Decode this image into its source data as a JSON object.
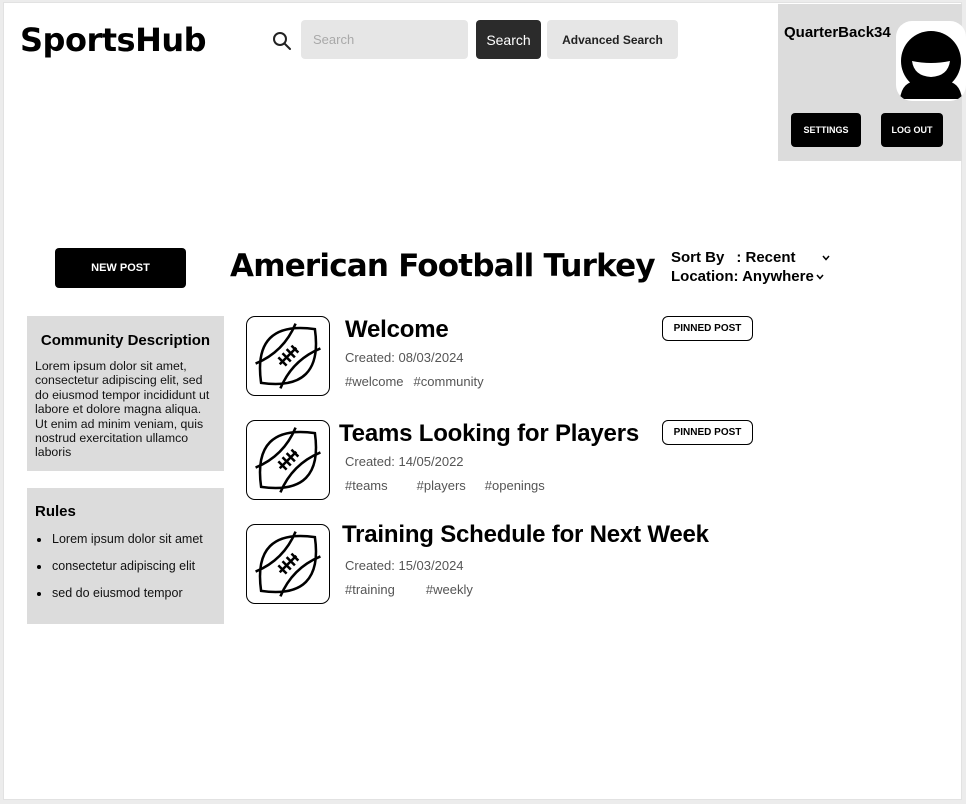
{
  "header": {
    "logo": "SportsHub",
    "search_placeholder": "Search",
    "search_button": "Search",
    "advanced_search": "Advanced Search"
  },
  "user": {
    "username": "QuarterBack34",
    "settings": "SETTINGS",
    "logout": "LOG OUT"
  },
  "community": {
    "new_post": "NEW POST",
    "title": "American Football Turkey",
    "sort_label": "Sort By",
    "sort_value": ": Recent",
    "location": "Location: Anywhere"
  },
  "sidebar": {
    "description_heading": "Community Description",
    "description_text": "Lorem ipsum dolor sit amet, consectetur adipiscing elit, sed do eiusmod tempor incididunt ut labore et dolore magna aliqua. Ut enim ad minim veniam, quis nostrud exercitation ullamco laboris",
    "rules_heading": "Rules",
    "rules": [
      "Lorem ipsum dolor sit amet",
      "consectetur adipiscing elit",
      "sed do eiusmod tempor"
    ]
  },
  "posts": [
    {
      "title": "Welcome",
      "created": "Created: 08/03/2024",
      "tags": [
        "#welcome",
        "#community"
      ],
      "badge": "PINNED POST",
      "icon": "football-icon"
    },
    {
      "title": "Teams Looking for Players",
      "created": "Created: 14/05/2022",
      "tags": [
        "#teams",
        "#players",
        "#openings"
      ],
      "badge": "PINNED POST",
      "icon": "football-icon"
    },
    {
      "title": "Training Schedule for Next Week",
      "created": "Created: 15/03/2024",
      "tags": [
        "#training",
        "#weekly"
      ],
      "badge": "",
      "icon": "football-icon"
    }
  ],
  "colors": {
    "panel": "#dcdcdc",
    "button_dark": "#000000",
    "search_button": "#2b2b2b",
    "input_bg": "#e6e6e6"
  }
}
